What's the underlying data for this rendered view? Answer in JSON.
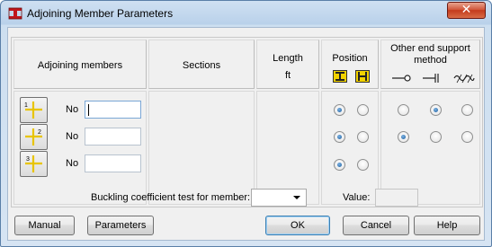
{
  "window": {
    "title": "Adjoining Member Parameters",
    "close_glyph": "✕"
  },
  "table": {
    "headers": {
      "adjoining_members": "Adjoining members",
      "sections": "Sections",
      "length": "Length",
      "length_unit": "ft",
      "position": "Position",
      "other_end_line1": "Other end support",
      "other_end_line2": "method"
    },
    "position_icons": [
      "i-beam-icon",
      "h-beam-icon"
    ],
    "support_icons": [
      "pinned-support-icon",
      "roller-support-icon",
      "fixed-support-icon"
    ],
    "members": [
      {
        "number": "1",
        "label": "No",
        "value": "",
        "focused": true,
        "position": 0,
        "support": 1
      },
      {
        "number": "2",
        "label": "No",
        "value": "",
        "focused": false,
        "position": 0,
        "support": 0
      },
      {
        "number": "3",
        "label": "No",
        "value": "",
        "focused": false,
        "position": 0,
        "support": null
      }
    ]
  },
  "buckling": {
    "label": "Buckling coefficient test for member:",
    "selected": ""
  },
  "value": {
    "label": "Value:",
    "text": ""
  },
  "buttons": {
    "manual": "Manual",
    "parameters": "Parameters",
    "ok": "OK",
    "cancel": "Cancel",
    "help": "Help"
  },
  "colors": {
    "accent": "#1b5e9e",
    "title_bg": "#b9d1ea",
    "close_red": "#c43b1c",
    "icon_yellow": "#f2d200"
  }
}
